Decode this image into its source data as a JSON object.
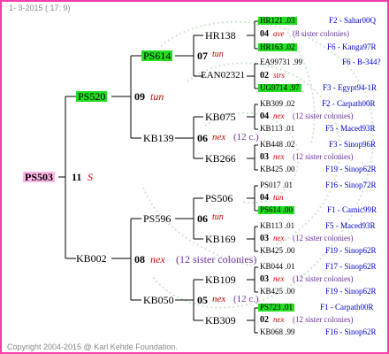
{
  "header": {
    "date_label": "1-  3-2015 ( 17:  9)"
  },
  "footer": {
    "copyright": "Copyright 2004-2015 @ Karl Kehde Foundation."
  },
  "colors": {
    "frame": "#ff3aa8",
    "pedigree_green": "#22dd22",
    "root_pink": "#ffb6e6",
    "link_blue": "#0000cc",
    "year_red": "#cc0000",
    "count_purple": "#6b2fa0"
  },
  "root": {
    "id": "PS503",
    "year_num": "11",
    "year_code": "S"
  },
  "gen1": {
    "top": {
      "id": "PS520",
      "year_num": "09",
      "year_code": "tun"
    },
    "bottom": {
      "id": "KB002",
      "year_num": "08",
      "year_code": "nex",
      "note": "(12 sister colonies)"
    }
  },
  "gen2": {
    "a": {
      "id": "PS614",
      "year_num": "07",
      "year_code": "tun"
    },
    "b": {
      "id": "KB139",
      "year_num": "06",
      "year_code": "nex",
      "note": "(12 c.)"
    },
    "c": {
      "id": "PS596",
      "year_num": "06",
      "year_code": "tun"
    },
    "d": {
      "id": "KB050",
      "year_num": "05",
      "year_code": "nex",
      "note": "(12 c.)"
    }
  },
  "gen3": {
    "a1": {
      "id": "HR138"
    },
    "a2": {
      "id": "EAN02321"
    },
    "b1": {
      "id": "KB075"
    },
    "b2": {
      "id": "KB266"
    },
    "c1": {
      "id": "PS506"
    },
    "c2": {
      "id": "KB169"
    },
    "d1": {
      "id": "KB109"
    },
    "d2": {
      "id": "KB309"
    }
  },
  "gen4": [
    {
      "code": "HR121 .03",
      "link": "F2 - Sahar00Q"
    },
    {
      "num": "04",
      "ycode": "ave",
      "note": "(8 sister colonies)"
    },
    {
      "code": "HR163 .02",
      "link": "F6 - Kanga97R"
    },
    {
      "code": "EA99731 .99",
      "link": "F6 - B-344?"
    },
    {
      "num": "02",
      "ycode": "strs",
      "note": ""
    },
    {
      "code": "UG9714 .97",
      "link": "F3 - Egypt94-1R"
    },
    {
      "code": "KB309 .02",
      "link": "F2 - Carpath00R"
    },
    {
      "num": "04",
      "ycode": "nex",
      "note": "(12 sister colonies)"
    },
    {
      "code": "KB113 .01",
      "link": "F5 - Maced93R"
    },
    {
      "code": "KB448 .02",
      "link": "F3 - Sinop96R"
    },
    {
      "num": "03",
      "ycode": "nex",
      "note": "(12 sister colonies)"
    },
    {
      "code": "KB425 .00",
      "link": "F19 - Sinop62R"
    },
    {
      "code": "PS017 .01",
      "link": "F16 - Sinop72R"
    },
    {
      "num": "04",
      "ycode": "tun",
      "note": ""
    },
    {
      "code": "PS614 .00",
      "link": "F1 - Carnic99R"
    },
    {
      "code": "KB113 .01",
      "link": "F5 - Maced93R"
    },
    {
      "num": "03",
      "ycode": "nex",
      "note": "(12 sister colonies)"
    },
    {
      "code": "KB425 .00",
      "link": "F19 - Sinop62R"
    },
    {
      "code": "KB044 .01",
      "link": "F17 - Sinop62R"
    },
    {
      "num": "03",
      "ycode": "nex",
      "note": "(12 sister colonies)"
    },
    {
      "code": "KB425 .00",
      "link": "F19 - Sinop62R"
    },
    {
      "code": "PS723 .01",
      "link": "F1 - Carpath00R"
    },
    {
      "num": "02",
      "ycode": "nex",
      "note": "(12 sister colonies)"
    },
    {
      "code": "KB068 .99",
      "link": "F16 - Sinop62R"
    }
  ]
}
